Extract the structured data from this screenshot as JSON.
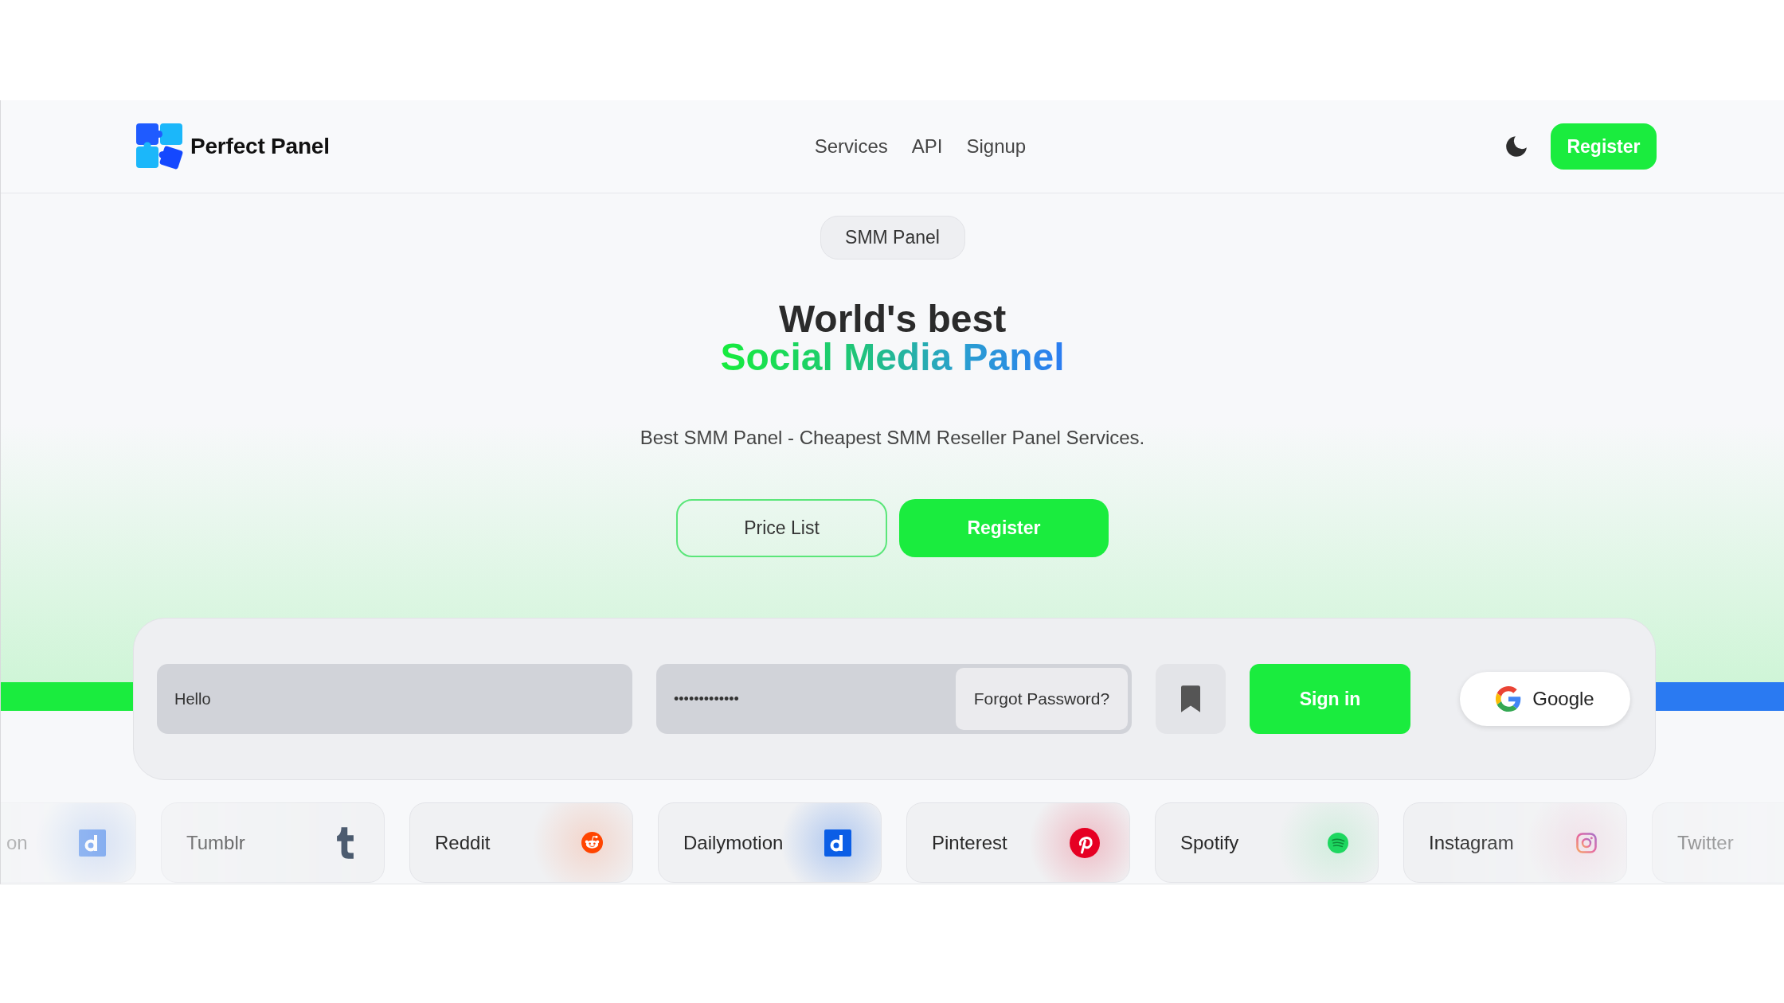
{
  "header": {
    "brand": "Perfect Panel",
    "nav": [
      {
        "label": "Services"
      },
      {
        "label": "API"
      },
      {
        "label": "Signup"
      }
    ],
    "register_button": "Register"
  },
  "hero": {
    "badge": "SMM Panel",
    "title": "World's best",
    "highlight": "Social Media Panel",
    "subtitle": "Best SMM Panel - Cheapest SMM Reseller Panel Services.",
    "buttons": [
      {
        "label": "Price List",
        "kind": "outline"
      },
      {
        "label": "Register",
        "kind": "primary"
      }
    ]
  },
  "login": {
    "username": {
      "value": "Hello"
    },
    "password": {
      "value": "•••••••••••••"
    },
    "forgot_password": "Forgot Password?",
    "sign_in": "Sign in",
    "google": "Google"
  },
  "platforms": [
    {
      "label": "on",
      "kind": "dailymotion"
    },
    {
      "label": "Tumblr",
      "kind": "tumblr"
    },
    {
      "label": "Reddit",
      "kind": "reddit"
    },
    {
      "label": "Dailymotion",
      "kind": "dailymotion"
    },
    {
      "label": "Pinterest",
      "kind": "pinterest"
    },
    {
      "label": "Spotify",
      "kind": "spotify"
    },
    {
      "label": "Instagram",
      "kind": "instagram"
    },
    {
      "label": "Twitter",
      "kind": "twitter"
    }
  ]
}
